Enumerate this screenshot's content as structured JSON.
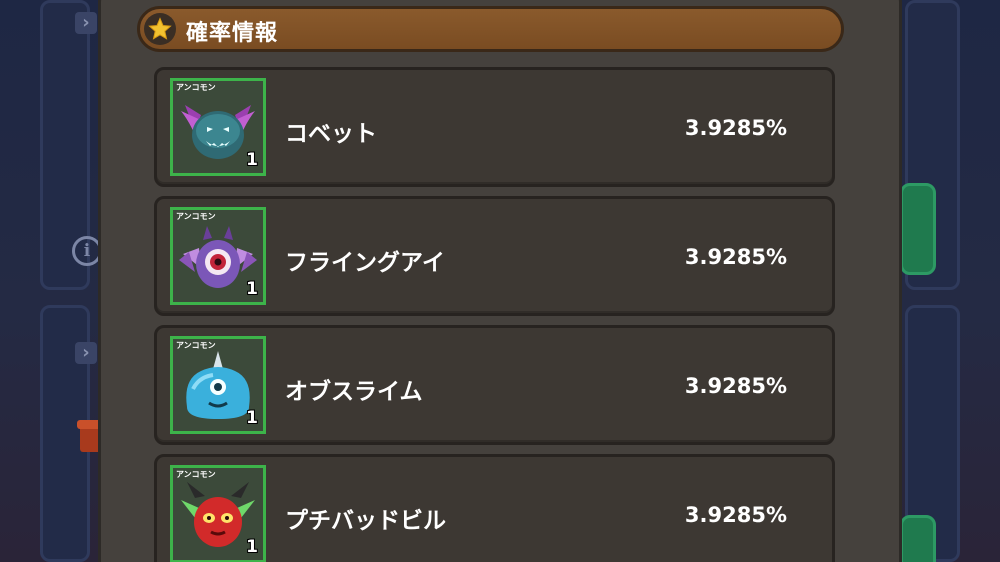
{
  "header": {
    "title": "確率情報",
    "icon": "star-icon"
  },
  "rows": [
    {
      "name": "コベット",
      "rate": "3.9285%",
      "rarity": "アンコモン",
      "count": "1",
      "icon": "kobet-bat-icon"
    },
    {
      "name": "フライングアイ",
      "rate": "3.9285%",
      "rarity": "アンコモン",
      "count": "1",
      "icon": "flying-eye-icon"
    },
    {
      "name": "オブスライム",
      "rate": "3.9285%",
      "rarity": "アンコモン",
      "count": "1",
      "icon": "ob-slime-icon"
    },
    {
      "name": "プチバッドビル",
      "rate": "3.9285%",
      "rarity": "アンコモン",
      "count": "1",
      "icon": "petit-bad-devil-icon"
    }
  ],
  "colors": {
    "frame_green": "#3db34a",
    "header_brown": "#7a4c22",
    "row_bg": "#3d3833"
  }
}
